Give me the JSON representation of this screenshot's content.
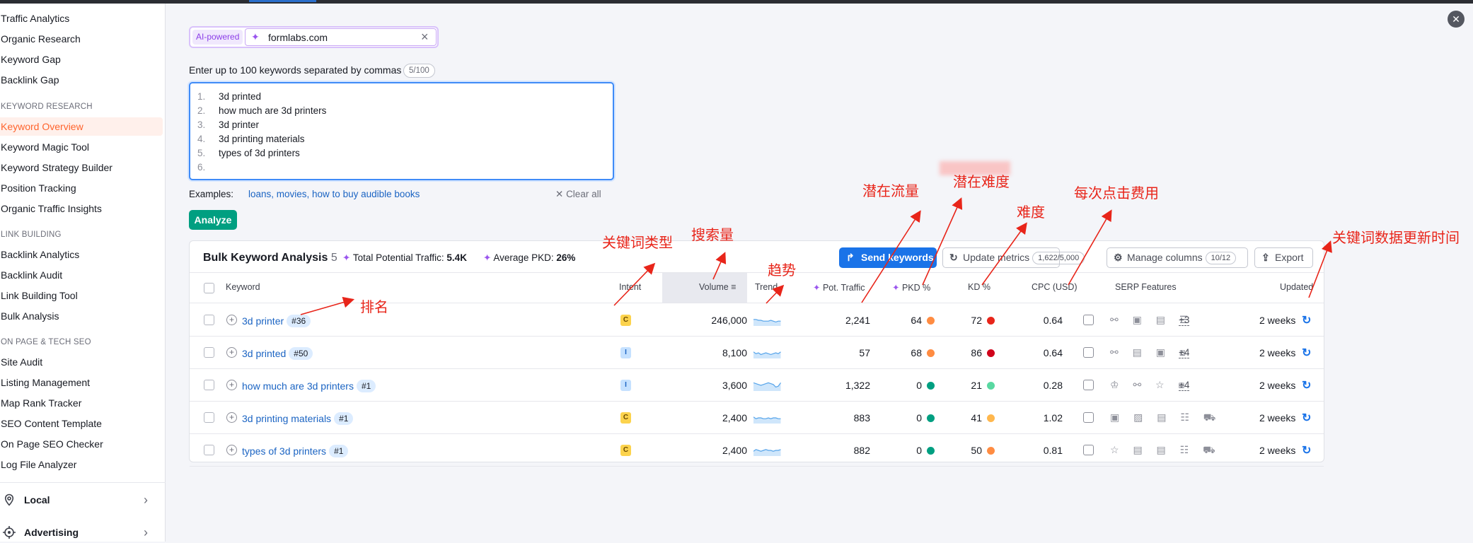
{
  "sidebar": {
    "items_top": [
      "Traffic Analytics",
      "Organic Research",
      "Keyword Gap",
      "Backlink Gap"
    ],
    "section_kr": "KEYWORD RESEARCH",
    "items_kr": [
      "Keyword Overview",
      "Keyword Magic Tool",
      "Keyword Strategy Builder",
      "Position Tracking",
      "Organic Traffic Insights"
    ],
    "section_lb": "LINK BUILDING",
    "items_lb": [
      "Backlink Analytics",
      "Backlink Audit",
      "Link Building Tool",
      "Bulk Analysis"
    ],
    "section_op": "ON PAGE & TECH SEO",
    "items_op": [
      "Site Audit",
      "Listing Management",
      "Map Rank Tracker",
      "SEO Content Template",
      "On Page SEO Checker",
      "Log File Analyzer"
    ],
    "bottom": [
      "Local",
      "Advertising"
    ]
  },
  "domain": {
    "ai_label": "AI-powered",
    "value": "formlabs.com"
  },
  "keywords_input": {
    "label": "Enter up to 100 keywords separated by commas",
    "count": "5/100",
    "lines": [
      "3d printed",
      "how much are 3d printers",
      "3d printer",
      "3d printing materials",
      "types of 3d printers",
      ""
    ],
    "line_numbers": [
      "1.",
      "2.",
      "3.",
      "4.",
      "5.",
      "6."
    ]
  },
  "examples": {
    "label": "Examples:",
    "links": "loans, movies, how to buy audible books",
    "clear": "Clear all"
  },
  "analyze_label": "Analyze",
  "panel": {
    "title": "Bulk Keyword Analysis",
    "count": "5",
    "total_traffic_label": "Total Potential Traffic:",
    "total_traffic": "5.4K",
    "avg_pkd_label": "Average PKD:",
    "avg_pkd": "26%",
    "send": "Send keywords",
    "update": "Update metrics",
    "update_count": "1,622/5,000",
    "manage": "Manage columns",
    "manage_count": "10/12",
    "export": "Export"
  },
  "columns": [
    "Keyword",
    "Intent",
    "Volume",
    "Trend",
    "Pot. Traffic",
    "PKD %",
    "KD %",
    "CPC (USD)",
    "SERP Features",
    "Updated"
  ],
  "rows": [
    {
      "keyword": "3d printer",
      "rank": "#36",
      "intent": "C",
      "volume": "246,000",
      "traffic": "2,241",
      "pkd": "64",
      "pkd_color": "#ff8c42",
      "kd": "72",
      "kd_color": "#e8251a",
      "cpc": "0.64",
      "serp": "⚯ ▣ ▤ ☰",
      "more": "+3",
      "updated": "2 weeks",
      "trend": [
        6,
        6,
        5,
        5,
        4,
        4,
        4,
        5,
        4,
        3,
        4,
        4
      ]
    },
    {
      "keyword": "3d printed",
      "rank": "#50",
      "intent": "I",
      "volume": "8,100",
      "traffic": "57",
      "pkd": "68",
      "pkd_color": "#ff8c42",
      "kd": "86",
      "kd_color": "#d0021b",
      "cpc": "0.64",
      "serp": "⚯ ▤ ▣ ⧇",
      "more": "+4",
      "updated": "2 weeks",
      "trend": [
        6,
        4,
        5,
        3,
        4,
        5,
        4,
        3,
        4,
        5,
        4,
        6
      ]
    },
    {
      "keyword": "how much are 3d printers",
      "rank": "#1",
      "intent": "I",
      "volume": "3,600",
      "traffic": "1,322",
      "pkd": "0",
      "pkd_color": "#009f81",
      "kd": "21",
      "kd_color": "#59d8a1",
      "cpc": "0.28",
      "serp": "♔ ⚯ ☆ ⧇",
      "more": "+4",
      "updated": "2 weeks",
      "trend": [
        8,
        7,
        6,
        5,
        6,
        7,
        8,
        7,
        6,
        3,
        4,
        8
      ]
    },
    {
      "keyword": "3d printing materials",
      "rank": "#1",
      "intent": "C",
      "volume": "2,400",
      "traffic": "883",
      "pkd": "0",
      "pkd_color": "#009f81",
      "kd": "41",
      "kd_color": "#ffb74d",
      "cpc": "1.02",
      "serp": "▣ ▨ ▤ ☷ ⛟",
      "more": "",
      "updated": "2 weeks",
      "trend": [
        6,
        4,
        5,
        5,
        4,
        4,
        5,
        4,
        5,
        5,
        4,
        4
      ]
    },
    {
      "keyword": "types of 3d printers",
      "rank": "#1",
      "intent": "C",
      "volume": "2,400",
      "traffic": "882",
      "pkd": "0",
      "pkd_color": "#009f81",
      "kd": "50",
      "kd_color": "#ff8c42",
      "cpc": "0.81",
      "serp": "☆ ▤ ▤ ☷ ⛟",
      "more": "",
      "updated": "2 weeks",
      "trend": [
        4,
        6,
        5,
        4,
        5,
        6,
        5,
        5,
        4,
        5,
        5,
        6
      ]
    }
  ],
  "annotations": {
    "rank": "排名",
    "intent": "关键词类型",
    "volume": "搜索量",
    "trend": "趋势",
    "traffic": "潜在流量",
    "pkd": "潜在难度",
    "kd": "难度",
    "cpc": "每次点击费用",
    "updated": "关键词数据更新时间"
  }
}
